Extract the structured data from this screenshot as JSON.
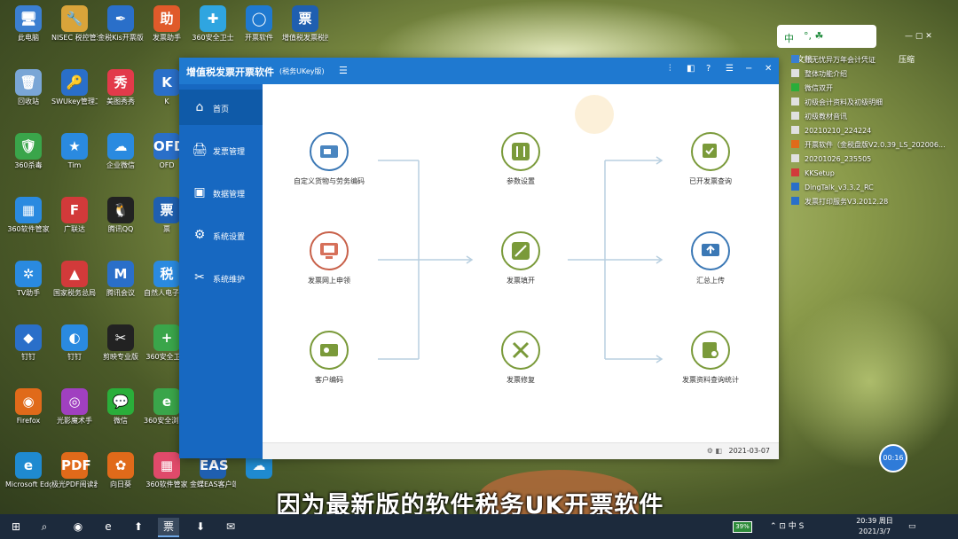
{
  "desktop_icons": [
    {
      "label": "此电脑",
      "glyph": "🖥",
      "color": "#3b7fd1",
      "col": 0,
      "row": 0
    },
    {
      "label": "NISEC 税控管理工具",
      "glyph": "🔧",
      "color": "#d9a43a",
      "col": 1,
      "row": 0
    },
    {
      "label": "金税Kis开票版",
      "glyph": "✒",
      "color": "#2a6fc9",
      "col": 2,
      "row": 0
    },
    {
      "label": "发票助手",
      "glyph": "助",
      "color": "#e05a2a",
      "col": 3,
      "row": 0
    },
    {
      "label": "360安全卫士",
      "glyph": "✚",
      "color": "#2fa5e0",
      "col": 4,
      "row": 0
    },
    {
      "label": "开票软件",
      "glyph": "◯",
      "color": "#1f79d0",
      "col": 5,
      "row": 0
    },
    {
      "label": "增值税发票税控开票软件",
      "glyph": "票",
      "color": "#1f5fb0",
      "col": 6,
      "row": 0
    },
    {
      "label": "回收站",
      "glyph": "🗑",
      "color": "#7aa6d6",
      "col": 0,
      "row": 1
    },
    {
      "label": "SWUkey管理工具",
      "glyph": "🔑",
      "color": "#2a6fc9",
      "col": 1,
      "row": 1
    },
    {
      "label": "美图秀秀",
      "glyph": "秀",
      "color": "#e23a4a",
      "col": 2,
      "row": 1
    },
    {
      "label": "K",
      "glyph": "K",
      "color": "#2a6fc9",
      "col": 3,
      "row": 1
    },
    {
      "label": "360杀毒",
      "glyph": "🛡",
      "color": "#3aa54a",
      "col": 0,
      "row": 2
    },
    {
      "label": "Tim",
      "glyph": "★",
      "color": "#2a8ae0",
      "col": 1,
      "row": 2
    },
    {
      "label": "企业微信",
      "glyph": "☁",
      "color": "#2a8ae0",
      "col": 2,
      "row": 2
    },
    {
      "label": "OFD",
      "glyph": "OFD",
      "color": "#2a6fc9",
      "col": 3,
      "row": 2
    },
    {
      "label": "360软件管家",
      "glyph": "▦",
      "color": "#2a8ae0",
      "col": 0,
      "row": 3
    },
    {
      "label": "广联达",
      "glyph": "F",
      "color": "#d23a3a",
      "col": 1,
      "row": 3
    },
    {
      "label": "腾讯QQ",
      "glyph": "🐧",
      "color": "#222",
      "col": 2,
      "row": 3
    },
    {
      "label": "票",
      "glyph": "票",
      "color": "#1f5fb0",
      "col": 3,
      "row": 3
    },
    {
      "label": "TV助手",
      "glyph": "✲",
      "color": "#2a8ae0",
      "col": 0,
      "row": 4
    },
    {
      "label": "国家税务总局",
      "glyph": "▲",
      "color": "#d23a3a",
      "col": 1,
      "row": 4
    },
    {
      "label": "腾讯会议",
      "glyph": "M",
      "color": "#2a6fc9",
      "col": 2,
      "row": 4
    },
    {
      "label": "自然人电子税务局",
      "glyph": "税",
      "color": "#2a8ae0",
      "col": 3,
      "row": 4
    },
    {
      "label": "钉钉",
      "glyph": "◆",
      "color": "#2a6fc9",
      "col": 0,
      "row": 5
    },
    {
      "label": "钉钉",
      "glyph": "◐",
      "color": "#2a8ae0",
      "col": 1,
      "row": 5
    },
    {
      "label": "剪映专业版",
      "glyph": "✂",
      "color": "#222",
      "col": 2,
      "row": 5
    },
    {
      "label": "360安全卫士",
      "glyph": "+",
      "color": "#3aa54a",
      "col": 3,
      "row": 5
    },
    {
      "label": "Firefox",
      "glyph": "◉",
      "color": "#e06a1a",
      "col": 0,
      "row": 6
    },
    {
      "label": "光影魔术手",
      "glyph": "◎",
      "color": "#a040c0",
      "col": 1,
      "row": 6
    },
    {
      "label": "微信",
      "glyph": "💬",
      "color": "#2aae3a",
      "col": 2,
      "row": 6
    },
    {
      "label": "360安全浏览器",
      "glyph": "e",
      "color": "#3aa54a",
      "col": 3,
      "row": 6
    },
    {
      "label": "Microsoft Edge",
      "glyph": "e",
      "color": "#1f8ad0",
      "col": 0,
      "row": 7
    },
    {
      "label": "极光PDF阅读器",
      "glyph": "PDF",
      "color": "#e06a1a",
      "col": 1,
      "row": 7
    },
    {
      "label": "向日葵",
      "glyph": "✿",
      "color": "#e06a1a",
      "col": 2,
      "row": 7
    },
    {
      "label": "360软件管家",
      "glyph": "▦",
      "color": "#e04a6a",
      "col": 3,
      "row": 7
    },
    {
      "label": "金蝶EAS客户端",
      "glyph": "EAS",
      "color": "#1f5fb0",
      "col": 4,
      "row": 7
    },
    {
      "label": "",
      "glyph": "☁",
      "color": "#1f8ad0",
      "col": 5,
      "row": 7
    }
  ],
  "app": {
    "title": "增值税发票开票软件",
    "subtitle": "(税务UKey版)",
    "toolbar_icons": [
      "pin-icon",
      "window-icon",
      "help-icon",
      "menu-icon",
      "minimize-icon",
      "close-icon"
    ],
    "toolbar_glyphs": [
      "⫶",
      "◧",
      "?",
      "☰",
      "−",
      "✕"
    ],
    "sidebar": [
      {
        "label": "首页",
        "glyph": "⌂",
        "name": "home"
      },
      {
        "label": "发票管理",
        "glyph": "🖨",
        "name": "invoice-management"
      },
      {
        "label": "数据管理",
        "glyph": "▣",
        "name": "data-management"
      },
      {
        "label": "系统设置",
        "glyph": "⚙",
        "name": "system-settings"
      },
      {
        "label": "系统维护",
        "glyph": "✂",
        "name": "system-maintenance"
      }
    ],
    "nodes": [
      {
        "label": "自定义货物与劳务编码",
        "name": "custom-goods-codes"
      },
      {
        "label": "发票网上申领",
        "name": "invoice-online-apply"
      },
      {
        "label": "客户编码",
        "name": "customer-codes"
      },
      {
        "label": "参数设置",
        "name": "parameter-settings"
      },
      {
        "label": "发票填开",
        "name": "invoice-issue"
      },
      {
        "label": "发票修复",
        "name": "invoice-repair"
      },
      {
        "label": "已开发票查询",
        "name": "issued-invoice-query"
      },
      {
        "label": "汇总上传",
        "name": "summary-upload"
      },
      {
        "label": "发票资料查询统计",
        "name": "invoice-data-statistics"
      }
    ],
    "status_date": "2021-03-07",
    "status_icons": "⚙ ◧"
  },
  "tray_top": {
    "ime_label": "中",
    "ime_dot": "°,  ☘",
    "left_label": "文档",
    "right_label": "压缩"
  },
  "right_list": [
    {
      "label": "账无忧异万年会计凭证",
      "color": "#3a7fd1"
    },
    {
      "label": "整体功能介绍",
      "color": "#e0e0e0"
    },
    {
      "label": "微信双开",
      "color": "#2aae3a"
    },
    {
      "label": "初级会计资料及初级明细",
      "color": "#e0e0e0"
    },
    {
      "label": "初级教材音讯",
      "color": "#e0e0e0"
    },
    {
      "label": "20210210_224224",
      "color": "#e0e0e0"
    },
    {
      "label": "开票软件（金税盘版V2.0.39_LS_202006...",
      "color": "#e06a1a"
    },
    {
      "label": "20201026_235505",
      "color": "#e0e0e0"
    },
    {
      "label": "KKSetup",
      "color": "#d23a3a"
    },
    {
      "label": "DingTalk_v3.3.2_RC",
      "color": "#2a6fc9"
    },
    {
      "label": "发票打印服务V3.2012.28",
      "color": "#2a6fc9"
    }
  ],
  "timer_label": "00:16",
  "subtitle_text": "因为最新版的软件税务UK开票软件",
  "taskbar": {
    "items": [
      "⊞",
      "⌕",
      "◉",
      "e",
      "⬆",
      "票",
      "⬇",
      "✉"
    ],
    "battery": "39%",
    "tray_text": "⌃  ⊡  中  S",
    "time": "20:39 周日",
    "date": "2021/3/7"
  }
}
